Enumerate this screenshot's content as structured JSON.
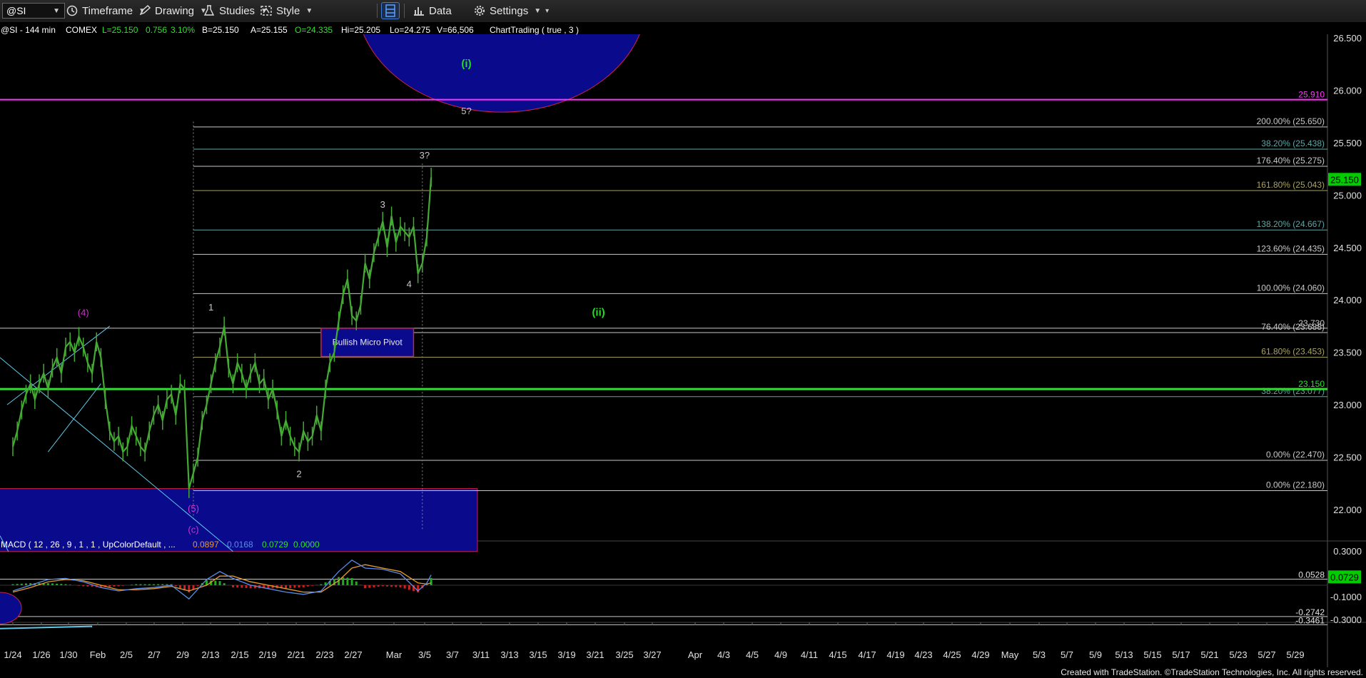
{
  "toolbar": {
    "symbol": "@SI",
    "timeframe": "Timeframe",
    "drawing": "Drawing",
    "studies": "Studies",
    "style": "Style",
    "data": "Data",
    "settings": "Settings"
  },
  "status_line": {
    "symbol": "@SI - 144 min",
    "exchange": "COMEX",
    "last": "L=25.150",
    "change": "0.756",
    "change_pct": "3.10%",
    "bid": "B=25.150",
    "ask": "A=25.155",
    "open": "O=24.335",
    "high": "Hi=25.205",
    "low": "Lo=24.275",
    "volume": "V=66,506",
    "study": "ChartTrading ( true , 3 )"
  },
  "macd_line": {
    "label": "MACD ( 12 , 26 , 9 , 1 , 1 , UpColorDefault , ...",
    "v1": "0.0897",
    "v2": "0.0168",
    "v3": "0.0729",
    "v4": "0.0000"
  },
  "footer": "Created with TradeStation. ©TradeStation Technologies, Inc. All rights reserved.",
  "colors": {
    "price": "#44aa33",
    "magenta": "#ff33ff",
    "green_line": "#33dd33",
    "blue_zone": "#0a0a8c",
    "teal": "#5fa6a6",
    "olive": "#a9a265",
    "bright_green": "#22dd22"
  },
  "chart_data": {
    "type": "line",
    "symbol": "@SI",
    "interval": "144 min",
    "y_axis": {
      "ylim": [
        21.6,
        26.6
      ],
      "ticks": [
        "26.500",
        "26.000",
        "25.500",
        "25.000",
        "24.500",
        "24.000",
        "23.500",
        "23.000",
        "22.500",
        "22.000"
      ],
      "tick_values": [
        26.5,
        26.0,
        25.5,
        25.0,
        24.5,
        24.0,
        23.5,
        23.0,
        22.5,
        22.0
      ],
      "last_price_label": "25.150",
      "last_price": 25.15
    },
    "x_axis": {
      "ticks": [
        "1/24",
        "1/26",
        "1/30",
        "Feb",
        "2/5",
        "2/7",
        "2/9",
        "2/13",
        "2/15",
        "2/19",
        "2/21",
        "2/23",
        "2/27",
        "Mar",
        "3/5",
        "3/7",
        "3/11",
        "3/13",
        "3/15",
        "3/19",
        "3/21",
        "3/25",
        "3/27",
        "Apr",
        "4/3",
        "4/5",
        "4/9",
        "4/11",
        "4/15",
        "4/17",
        "4/19",
        "4/23",
        "4/25",
        "4/29",
        "May",
        "5/3",
        "5/7",
        "5/9",
        "5/13",
        "5/15",
        "5/17",
        "5/21",
        "5/23",
        "5/27",
        "5/29"
      ]
    },
    "price_series": {
      "name": "",
      "points": [
        [
          0,
          22.6
        ],
        [
          1,
          22.75
        ],
        [
          2,
          22.95
        ],
        [
          3,
          23.1
        ],
        [
          4,
          23.2
        ],
        [
          5,
          23.05
        ],
        [
          6,
          23.2
        ],
        [
          7,
          23.3
        ],
        [
          8,
          23.15
        ],
        [
          9,
          23.35
        ],
        [
          10,
          23.45
        ],
        [
          11,
          23.3
        ],
        [
          12,
          23.55
        ],
        [
          13,
          23.6
        ],
        [
          14,
          23.5
        ],
        [
          15,
          23.65
        ],
        [
          16,
          23.55
        ],
        [
          17,
          23.4
        ],
        [
          18,
          23.3
        ],
        [
          19,
          23.6
        ],
        [
          20,
          23.45
        ],
        [
          21,
          23.05
        ],
        [
          22,
          22.75
        ],
        [
          23,
          22.65
        ],
        [
          24,
          22.7
        ],
        [
          25,
          22.55
        ],
        [
          26,
          22.6
        ],
        [
          27,
          22.8
        ],
        [
          28,
          22.7
        ],
        [
          29,
          22.6
        ],
        [
          30,
          22.55
        ],
        [
          31,
          22.75
        ],
        [
          32,
          22.9
        ],
        [
          33,
          23.0
        ],
        [
          34,
          22.85
        ],
        [
          35,
          23.05
        ],
        [
          36,
          23.1
        ],
        [
          37,
          22.9
        ],
        [
          38,
          23.2
        ],
        [
          39,
          23.15
        ],
        [
          40,
          22.2
        ],
        [
          41,
          22.35
        ],
        [
          42,
          22.5
        ],
        [
          43,
          22.85
        ],
        [
          44,
          23.0
        ],
        [
          45,
          23.2
        ],
        [
          46,
          23.4
        ],
        [
          47,
          23.55
        ],
        [
          48,
          23.75
        ],
        [
          49,
          23.35
        ],
        [
          50,
          23.2
        ],
        [
          51,
          23.4
        ],
        [
          52,
          23.3
        ],
        [
          53,
          23.15
        ],
        [
          54,
          23.3
        ],
        [
          55,
          23.4
        ],
        [
          56,
          23.2
        ],
        [
          57,
          23.25
        ],
        [
          58,
          23.05
        ],
        [
          59,
          23.15
        ],
        [
          60,
          22.95
        ],
        [
          61,
          22.7
        ],
        [
          62,
          22.85
        ],
        [
          63,
          22.7
        ],
        [
          64,
          22.6
        ],
        [
          65,
          22.55
        ],
        [
          66,
          22.75
        ],
        [
          67,
          22.65
        ],
        [
          68,
          22.7
        ],
        [
          69,
          22.9
        ],
        [
          70,
          22.75
        ],
        [
          71,
          23.15
        ],
        [
          72,
          23.4
        ],
        [
          73,
          23.5
        ],
        [
          74,
          23.8
        ],
        [
          75,
          24.05
        ],
        [
          76,
          24.2
        ],
        [
          77,
          23.85
        ],
        [
          78,
          23.8
        ],
        [
          79,
          23.95
        ],
        [
          80,
          24.35
        ],
        [
          81,
          24.2
        ],
        [
          82,
          24.45
        ],
        [
          83,
          24.6
        ],
        [
          84,
          24.75
        ],
        [
          85,
          24.5
        ],
        [
          86,
          24.8
        ],
        [
          87,
          24.55
        ],
        [
          88,
          24.7
        ],
        [
          89,
          24.65
        ],
        [
          90,
          24.6
        ],
        [
          91,
          24.7
        ],
        [
          92,
          24.25
        ],
        [
          93,
          24.35
        ],
        [
          94,
          24.6
        ],
        [
          95,
          25.17
        ]
      ]
    },
    "fib_levels": [
      {
        "label": "200.00% (25.650)",
        "value": 25.65,
        "color": "#c8c8c8"
      },
      {
        "label": "38.20% (25.438)",
        "value": 25.438,
        "color": "#5fa6a6"
      },
      {
        "label": "176.40% (25.275)",
        "value": 25.275,
        "color": "#c8c8c8"
      },
      {
        "label": "161.80% (25.043)",
        "value": 25.043,
        "color": "#a9a265"
      },
      {
        "label": "138.20% (24.667)",
        "value": 24.667,
        "color": "#5fa6a6"
      },
      {
        "label": "123.60% (24.435)",
        "value": 24.435,
        "color": "#c8c8c8"
      },
      {
        "label": "100.00% (24.060)",
        "value": 24.06,
        "color": "#c8c8c8"
      },
      {
        "label": "76.40% (23.688)",
        "value": 23.688,
        "color": "#c8c8c8"
      },
      {
        "label": "61.80% (23.453)",
        "value": 23.453,
        "color": "#a9a265"
      },
      {
        "label": "38.20% (23.077)",
        "value": 23.077,
        "color": "#5fa6a6"
      },
      {
        "label": "0.00% (22.470)",
        "value": 22.47,
        "color": "#c8c8c8"
      },
      {
        "label": "0.00% (22.180)",
        "value": 22.18,
        "color": "#c8c8c8"
      }
    ],
    "horizontal_lines": [
      {
        "label": "25.910",
        "value": 25.91,
        "color": "#ff33ff"
      },
      {
        "label": "23.730",
        "value": 23.73,
        "color": "#c8c8c8"
      },
      {
        "label": "23.150",
        "value": 23.15,
        "color": "#33dd33"
      }
    ],
    "wave_labels": [
      {
        "text": "(4)",
        "x": 16,
        "y": 23.85,
        "color": "#cc33cc"
      },
      {
        "text": "(5)",
        "x": 41,
        "y": 21.98,
        "color": "#cc33cc"
      },
      {
        "text": "(c)",
        "x": 41,
        "y": 21.78,
        "color": "#cc33cc"
      },
      {
        "text": "1",
        "x": 45,
        "y": 23.9,
        "color": "#c8c8c8"
      },
      {
        "text": "2",
        "x": 65,
        "y": 22.31,
        "color": "#c8c8c8"
      },
      {
        "text": "3",
        "x": 84,
        "y": 24.88,
        "color": "#c8c8c8"
      },
      {
        "text": "4",
        "x": 90,
        "y": 24.12,
        "color": "#c8c8c8"
      },
      {
        "text": "3?",
        "x": 93.5,
        "y": 25.35,
        "color": "#c8c8c8"
      },
      {
        "text": "5?",
        "x": 103,
        "y": 25.77,
        "color": "#c8c8c8"
      },
      {
        "text": "(i)",
        "x": 103,
        "y": 26.22,
        "color": "#22dd22"
      },
      {
        "text": "(ii)",
        "x": 133,
        "y": 23.85,
        "color": "#22dd22"
      }
    ],
    "annotations": [
      {
        "text": "Bullish Micro Pivot",
        "x_start": 70,
        "x_end": 91,
        "y_low": 23.46,
        "y_high": 23.73
      }
    ],
    "zones": [
      {
        "name": "support-zone",
        "x_start": -7,
        "x_end": 105.5,
        "y_low": 21.6,
        "y_high": 22.2
      },
      {
        "name": "target-zone",
        "x_start": 78,
        "x_end": 144,
        "y_low": 25.9,
        "y_high": 26.6
      }
    ],
    "macd": {
      "ticks": [
        "0.3000",
        "-0.1000",
        "-0.3000"
      ],
      "tick_values": [
        0.3,
        -0.1,
        -0.3
      ],
      "ylim": [
        -0.42,
        0.36
      ],
      "levels": [
        {
          "label": "0.0528",
          "value": 0.0528
        },
        {
          "label": "-0.2742",
          "value": -0.2742
        },
        {
          "label": "-0.3461",
          "value": -0.3461
        }
      ],
      "current_label": "0.0729",
      "current": 0.0729,
      "macd_line": [
        [
          0,
          -0.05
        ],
        [
          4,
          0.0
        ],
        [
          8,
          0.05
        ],
        [
          12,
          0.06
        ],
        [
          16,
          0.03
        ],
        [
          20,
          -0.02
        ],
        [
          24,
          -0.05
        ],
        [
          28,
          -0.03
        ],
        [
          32,
          -0.02
        ],
        [
          36,
          0.0
        ],
        [
          40,
          -0.12
        ],
        [
          44,
          0.05
        ],
        [
          47,
          0.12
        ],
        [
          50,
          0.06
        ],
        [
          54,
          0.0
        ],
        [
          58,
          -0.03
        ],
        [
          62,
          -0.06
        ],
        [
          66,
          -0.08
        ],
        [
          70,
          -0.05
        ],
        [
          74,
          0.12
        ],
        [
          77,
          0.22
        ],
        [
          80,
          0.15
        ],
        [
          84,
          0.14
        ],
        [
          88,
          0.1
        ],
        [
          92,
          -0.05
        ],
        [
          94,
          0.02
        ],
        [
          95,
          0.09
        ]
      ],
      "signal_line": [
        [
          0,
          -0.06
        ],
        [
          4,
          -0.02
        ],
        [
          8,
          0.03
        ],
        [
          12,
          0.05
        ],
        [
          16,
          0.04
        ],
        [
          20,
          0.0
        ],
        [
          24,
          -0.04
        ],
        [
          28,
          -0.04
        ],
        [
          32,
          -0.03
        ],
        [
          36,
          -0.01
        ],
        [
          40,
          -0.05
        ],
        [
          44,
          0.0
        ],
        [
          47,
          0.08
        ],
        [
          50,
          0.08
        ],
        [
          54,
          0.03
        ],
        [
          58,
          0.0
        ],
        [
          62,
          -0.03
        ],
        [
          66,
          -0.06
        ],
        [
          70,
          -0.06
        ],
        [
          74,
          0.04
        ],
        [
          77,
          0.15
        ],
        [
          80,
          0.18
        ],
        [
          84,
          0.15
        ],
        [
          88,
          0.12
        ],
        [
          92,
          0.02
        ],
        [
          94,
          0.01
        ],
        [
          95,
          0.02
        ]
      ]
    }
  }
}
